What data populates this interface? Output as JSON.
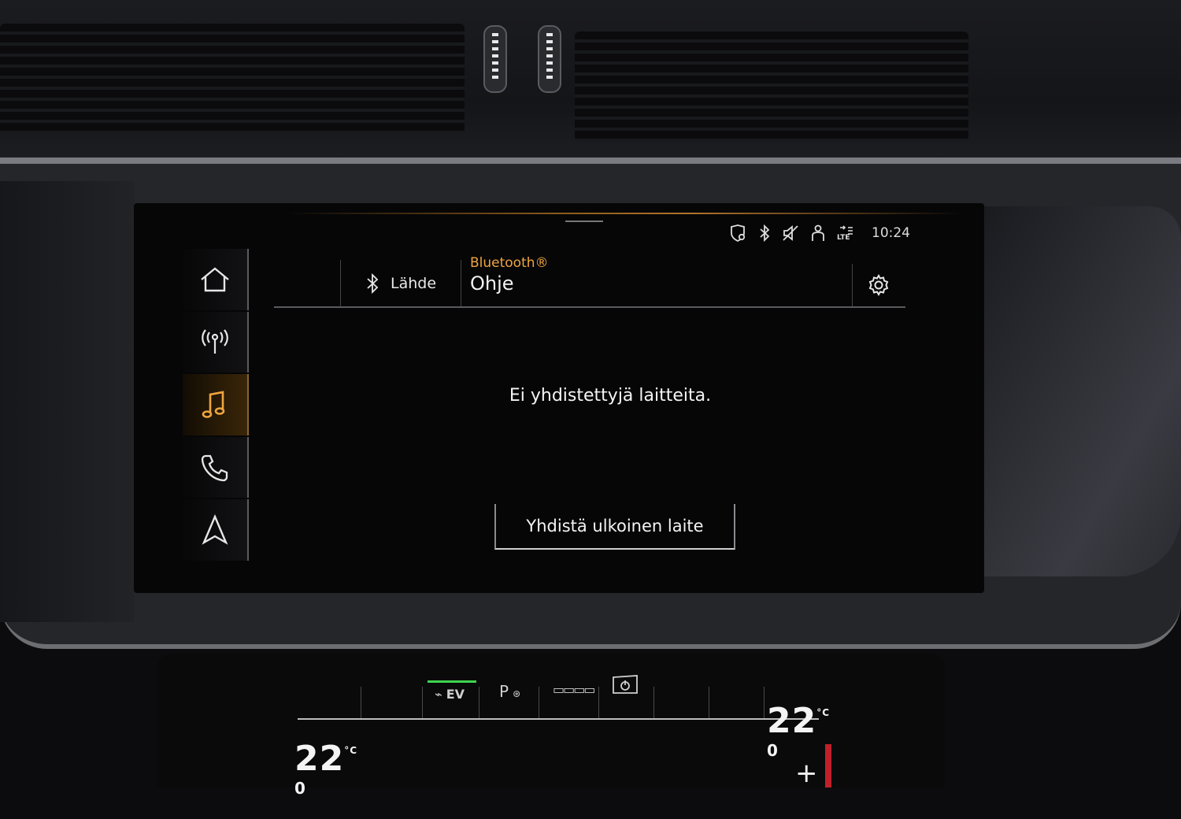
{
  "status_bar": {
    "icons": [
      "location-shield-icon",
      "bluetooth-icon",
      "mute-icon",
      "person-help-icon",
      "lte-signal-icon"
    ],
    "lte_label": "LTE",
    "time": "10:24"
  },
  "sidebar": {
    "items": [
      {
        "name": "home",
        "icon": "home-icon",
        "active": false
      },
      {
        "name": "radio",
        "icon": "radio-antenna-icon",
        "active": false
      },
      {
        "name": "media",
        "icon": "music-note-icon",
        "active": true
      },
      {
        "name": "phone",
        "icon": "phone-icon",
        "active": false
      },
      {
        "name": "navigation",
        "icon": "navigation-arrow-icon",
        "active": false
      }
    ]
  },
  "header": {
    "source_label": "Lähde",
    "subtitle": "Bluetooth®",
    "title": "Ohje"
  },
  "content": {
    "message": "Ei yhdistettyjä laitteita.",
    "connect_button": "Yhdistä ulkoinen laite"
  },
  "climate": {
    "ev_label": "EV",
    "p_label": "P",
    "left_temp": "22",
    "left_temp_decimal": "0",
    "right_temp": "22",
    "right_temp_decimal": "0",
    "unit": "°C",
    "plus_label": "+"
  },
  "colors": {
    "accent": "#f0a540",
    "ev_green": "#3fd44f"
  }
}
